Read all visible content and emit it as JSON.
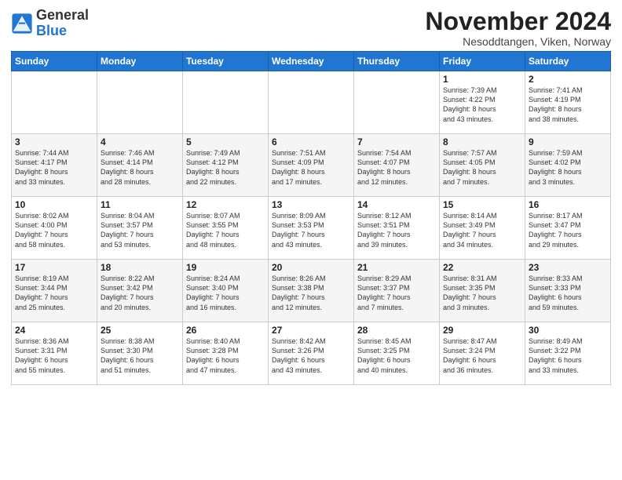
{
  "header": {
    "logo_general": "General",
    "logo_blue": "Blue",
    "month_title": "November 2024",
    "location": "Nesoddtangen, Viken, Norway"
  },
  "weekdays": [
    "Sunday",
    "Monday",
    "Tuesday",
    "Wednesday",
    "Thursday",
    "Friday",
    "Saturday"
  ],
  "weeks": [
    [
      {
        "day": "",
        "info": ""
      },
      {
        "day": "",
        "info": ""
      },
      {
        "day": "",
        "info": ""
      },
      {
        "day": "",
        "info": ""
      },
      {
        "day": "",
        "info": ""
      },
      {
        "day": "1",
        "info": "Sunrise: 7:39 AM\nSunset: 4:22 PM\nDaylight: 8 hours\nand 43 minutes."
      },
      {
        "day": "2",
        "info": "Sunrise: 7:41 AM\nSunset: 4:19 PM\nDaylight: 8 hours\nand 38 minutes."
      }
    ],
    [
      {
        "day": "3",
        "info": "Sunrise: 7:44 AM\nSunset: 4:17 PM\nDaylight: 8 hours\nand 33 minutes."
      },
      {
        "day": "4",
        "info": "Sunrise: 7:46 AM\nSunset: 4:14 PM\nDaylight: 8 hours\nand 28 minutes."
      },
      {
        "day": "5",
        "info": "Sunrise: 7:49 AM\nSunset: 4:12 PM\nDaylight: 8 hours\nand 22 minutes."
      },
      {
        "day": "6",
        "info": "Sunrise: 7:51 AM\nSunset: 4:09 PM\nDaylight: 8 hours\nand 17 minutes."
      },
      {
        "day": "7",
        "info": "Sunrise: 7:54 AM\nSunset: 4:07 PM\nDaylight: 8 hours\nand 12 minutes."
      },
      {
        "day": "8",
        "info": "Sunrise: 7:57 AM\nSunset: 4:05 PM\nDaylight: 8 hours\nand 7 minutes."
      },
      {
        "day": "9",
        "info": "Sunrise: 7:59 AM\nSunset: 4:02 PM\nDaylight: 8 hours\nand 3 minutes."
      }
    ],
    [
      {
        "day": "10",
        "info": "Sunrise: 8:02 AM\nSunset: 4:00 PM\nDaylight: 7 hours\nand 58 minutes."
      },
      {
        "day": "11",
        "info": "Sunrise: 8:04 AM\nSunset: 3:57 PM\nDaylight: 7 hours\nand 53 minutes."
      },
      {
        "day": "12",
        "info": "Sunrise: 8:07 AM\nSunset: 3:55 PM\nDaylight: 7 hours\nand 48 minutes."
      },
      {
        "day": "13",
        "info": "Sunrise: 8:09 AM\nSunset: 3:53 PM\nDaylight: 7 hours\nand 43 minutes."
      },
      {
        "day": "14",
        "info": "Sunrise: 8:12 AM\nSunset: 3:51 PM\nDaylight: 7 hours\nand 39 minutes."
      },
      {
        "day": "15",
        "info": "Sunrise: 8:14 AM\nSunset: 3:49 PM\nDaylight: 7 hours\nand 34 minutes."
      },
      {
        "day": "16",
        "info": "Sunrise: 8:17 AM\nSunset: 3:47 PM\nDaylight: 7 hours\nand 29 minutes."
      }
    ],
    [
      {
        "day": "17",
        "info": "Sunrise: 8:19 AM\nSunset: 3:44 PM\nDaylight: 7 hours\nand 25 minutes."
      },
      {
        "day": "18",
        "info": "Sunrise: 8:22 AM\nSunset: 3:42 PM\nDaylight: 7 hours\nand 20 minutes."
      },
      {
        "day": "19",
        "info": "Sunrise: 8:24 AM\nSunset: 3:40 PM\nDaylight: 7 hours\nand 16 minutes."
      },
      {
        "day": "20",
        "info": "Sunrise: 8:26 AM\nSunset: 3:38 PM\nDaylight: 7 hours\nand 12 minutes."
      },
      {
        "day": "21",
        "info": "Sunrise: 8:29 AM\nSunset: 3:37 PM\nDaylight: 7 hours\nand 7 minutes."
      },
      {
        "day": "22",
        "info": "Sunrise: 8:31 AM\nSunset: 3:35 PM\nDaylight: 7 hours\nand 3 minutes."
      },
      {
        "day": "23",
        "info": "Sunrise: 8:33 AM\nSunset: 3:33 PM\nDaylight: 6 hours\nand 59 minutes."
      }
    ],
    [
      {
        "day": "24",
        "info": "Sunrise: 8:36 AM\nSunset: 3:31 PM\nDaylight: 6 hours\nand 55 minutes."
      },
      {
        "day": "25",
        "info": "Sunrise: 8:38 AM\nSunset: 3:30 PM\nDaylight: 6 hours\nand 51 minutes."
      },
      {
        "day": "26",
        "info": "Sunrise: 8:40 AM\nSunset: 3:28 PM\nDaylight: 6 hours\nand 47 minutes."
      },
      {
        "day": "27",
        "info": "Sunrise: 8:42 AM\nSunset: 3:26 PM\nDaylight: 6 hours\nand 43 minutes."
      },
      {
        "day": "28",
        "info": "Sunrise: 8:45 AM\nSunset: 3:25 PM\nDaylight: 6 hours\nand 40 minutes."
      },
      {
        "day": "29",
        "info": "Sunrise: 8:47 AM\nSunset: 3:24 PM\nDaylight: 6 hours\nand 36 minutes."
      },
      {
        "day": "30",
        "info": "Sunrise: 8:49 AM\nSunset: 3:22 PM\nDaylight: 6 hours\nand 33 minutes."
      }
    ]
  ]
}
